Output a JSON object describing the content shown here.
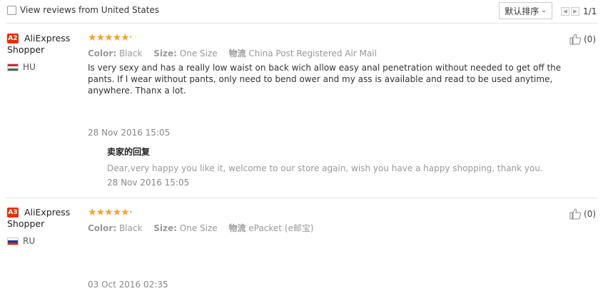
{
  "filter": {
    "label": "View reviews from United States",
    "checked": false
  },
  "sort": {
    "label": "默认排序"
  },
  "pager": {
    "page": "1/1"
  },
  "reviews": [
    {
      "badge": "A2",
      "user_line1": "AliExpress",
      "user_line2": "Shopper",
      "country": "HU",
      "flag_colors": [
        "#cd2a3e",
        "#ffffff",
        "#436f4d"
      ],
      "rating": 5,
      "color_label": "Color:",
      "color_value": "Black",
      "size_label": "Size:",
      "size_value": "One Size",
      "logistics_label": "物流",
      "logistics_value": "China Post Registered Air Mail",
      "text": "Is very sexy and has a really low waist on back wich allow easy anal penetration without needed to get off the pants. If I wear without pants, only need to bend ower and my ass is available and read to be used anytime, anywhere. Thanx a lot.",
      "date": "28 Nov 2016 15:05",
      "reply": {
        "title": "卖家的回复",
        "text": "Dear,very happy you like it, welcome to our store again, wish you have a happy shopping, thank you.",
        "date": "28 Nov 2016 15:05"
      },
      "likes": "(0)"
    },
    {
      "badge": "A3",
      "user_line1": "AliExpress",
      "user_line2": "Shopper",
      "country": "RU",
      "flag_colors": [
        "#ffffff",
        "#0039a6",
        "#d52b1e"
      ],
      "rating": 5,
      "color_label": "Color:",
      "color_value": "Black",
      "size_label": "Size:",
      "size_value": "One Size",
      "logistics_label": "物流",
      "logistics_value": "ePacket (e邮宝)",
      "date": "03 Oct 2016 02:35",
      "likes": "(0)"
    }
  ]
}
